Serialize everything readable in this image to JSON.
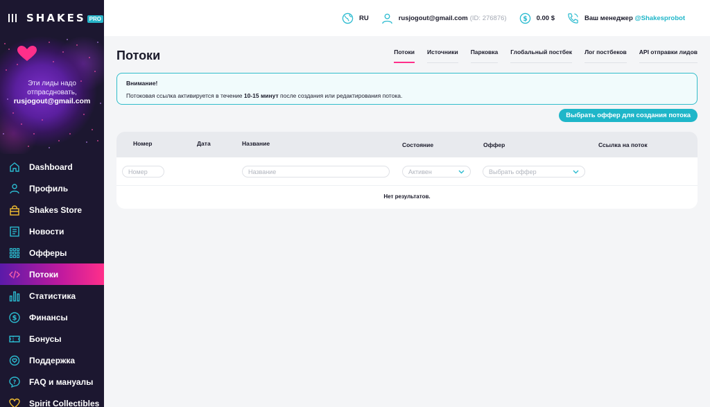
{
  "brand": {
    "name": "SHAKES",
    "badge": "PRO"
  },
  "promo": {
    "line1": "Эти лиды надо",
    "line2": "отпрасдновать,",
    "email": "rusjogout@gmail.com"
  },
  "nav": [
    {
      "label": "Dashboard",
      "icon": "home-icon"
    },
    {
      "label": "Профиль",
      "icon": "user-icon"
    },
    {
      "label": "Shakes Store",
      "icon": "bag-icon"
    },
    {
      "label": "Новости",
      "icon": "news-icon"
    },
    {
      "label": "Офферы",
      "icon": "grid-icon"
    },
    {
      "label": "Потоки",
      "icon": "code-icon",
      "active": true
    },
    {
      "label": "Статистика",
      "icon": "chart-icon"
    },
    {
      "label": "Финансы",
      "icon": "dollar-icon"
    },
    {
      "label": "Бонусы",
      "icon": "ticket-icon"
    },
    {
      "label": "Поддержка",
      "icon": "support-icon"
    },
    {
      "label": "FAQ и мануалы",
      "icon": "question-icon"
    },
    {
      "label": "Spirit Collectibles",
      "icon": "heart-icon"
    }
  ],
  "topbar": {
    "lang": "RU",
    "email": "rusjogout@gmail.com",
    "user_id": "(ID: 276876)",
    "balance": "0.00 $",
    "manager_label": "Ваш менеджер",
    "manager_handle": "@Shakesprobot"
  },
  "page": {
    "title": "Потоки"
  },
  "tabs": [
    "Потоки",
    "Источники",
    "Парковка",
    "Глобальный постбек",
    "Лог постбеков",
    "API отправки лидов"
  ],
  "alert": {
    "title": "Внимание!",
    "text_before": "Потоковая ссылка активируется в течение ",
    "text_bold": "10-15 минут",
    "text_after": " после создания или редактирования потока."
  },
  "offer_button": "Выбрать оффер для создания потока",
  "table": {
    "headers": [
      "Номер",
      "Дата",
      "Название",
      "Состояние",
      "Оффер",
      "Ссылка на поток"
    ],
    "filters": {
      "number_placeholder": "Номер",
      "name_placeholder": "Название",
      "state_value": "Активен",
      "offer_placeholder": "Выбрать оффер"
    },
    "empty": "Нет результатов."
  },
  "colors": {
    "accent": "#1fb6c9",
    "pink": "#ff2f8a",
    "sidebar": "#1c1730"
  }
}
